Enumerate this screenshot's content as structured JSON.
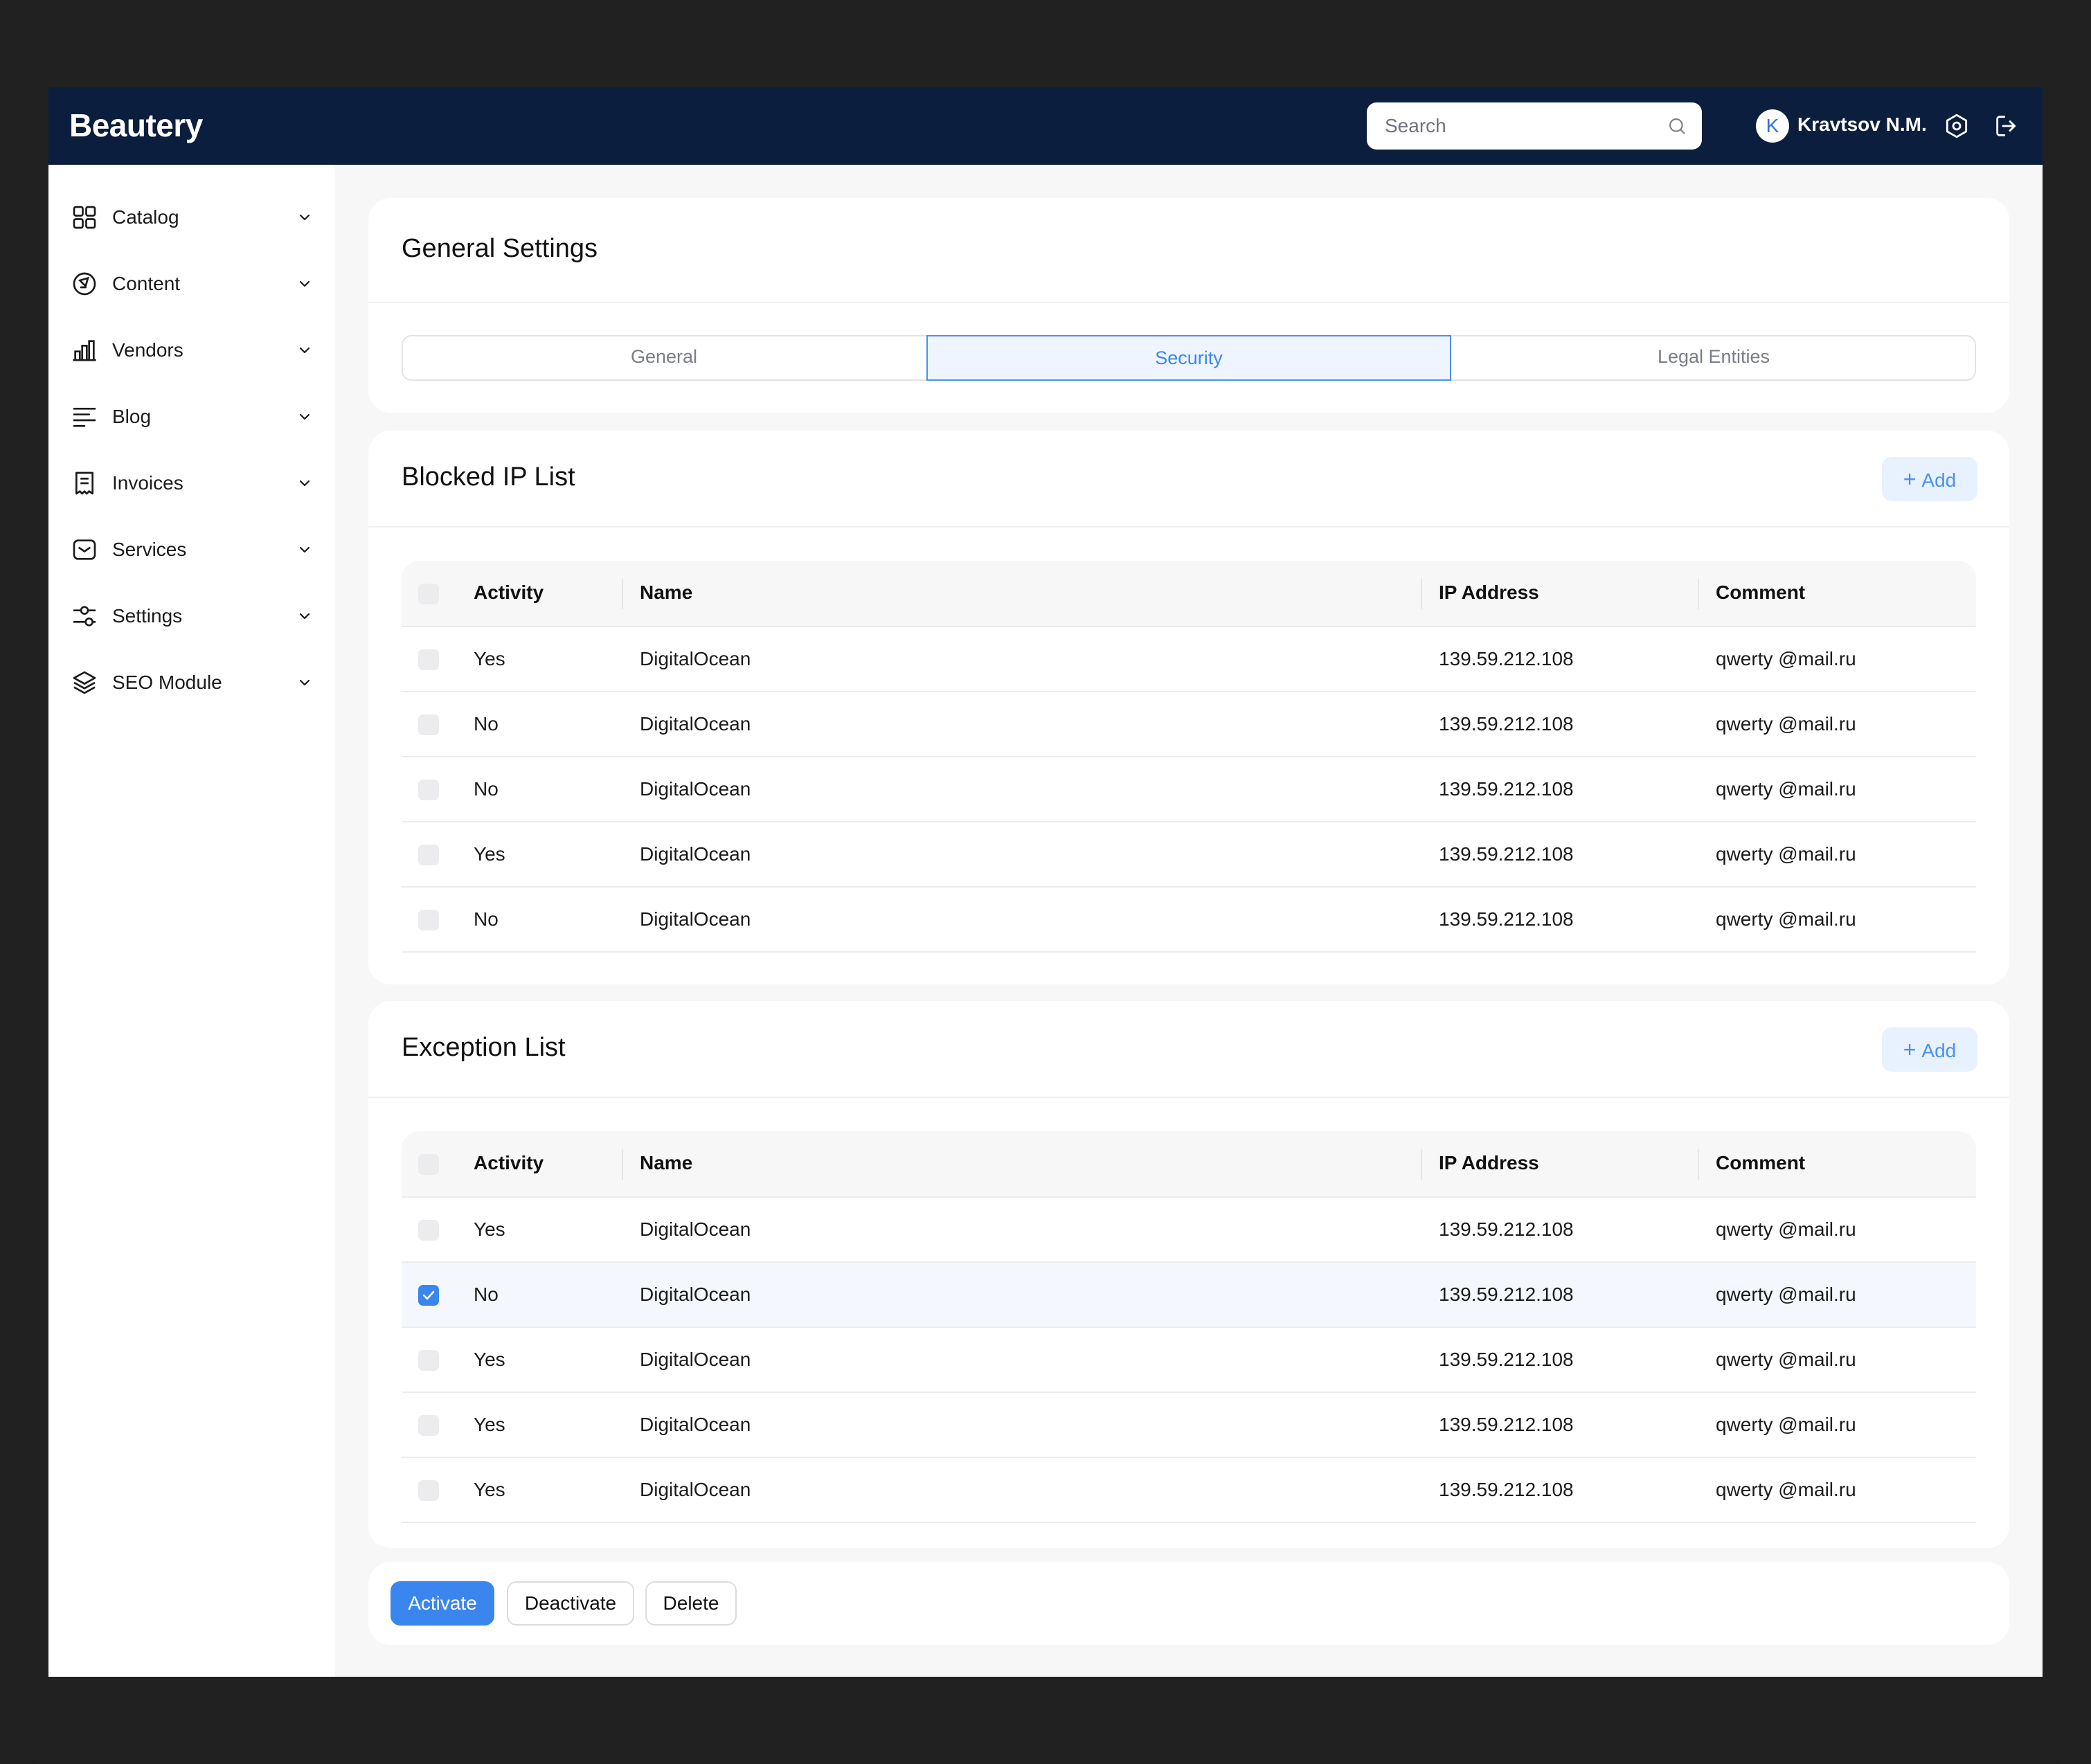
{
  "app": {
    "name": "Beautery"
  },
  "search": {
    "placeholder": "Search"
  },
  "user": {
    "initial": "K",
    "name": "Kravtsov N.M."
  },
  "sidebar": {
    "items": [
      {
        "label": "Catalog",
        "icon": "grid-icon"
      },
      {
        "label": "Content",
        "icon": "content-icon"
      },
      {
        "label": "Vendors",
        "icon": "bar-chart-icon"
      },
      {
        "label": "Blog",
        "icon": "text-lines-icon"
      },
      {
        "label": "Invoices",
        "icon": "receipt-icon"
      },
      {
        "label": "Services",
        "icon": "mail-icon"
      },
      {
        "label": "Settings",
        "icon": "sliders-icon"
      },
      {
        "label": "SEO Module",
        "icon": "layers-icon"
      }
    ]
  },
  "general_settings": {
    "title": "General Settings",
    "tabs": [
      {
        "label": "General",
        "active": false
      },
      {
        "label": "Security",
        "active": true
      },
      {
        "label": "Legal Entities",
        "active": false
      }
    ]
  },
  "columns": {
    "activity": "Activity",
    "name": "Name",
    "ip": "IP Address",
    "comment": "Comment"
  },
  "blocked": {
    "title": "Blocked IP List",
    "add_label": "Add",
    "rows": [
      {
        "checked": false,
        "activity": "Yes",
        "name": "DigitalOcean",
        "ip": "139.59.212.108",
        "comment": "qwerty @mail.ru"
      },
      {
        "checked": false,
        "activity": "No",
        "name": "DigitalOcean",
        "ip": "139.59.212.108",
        "comment": "qwerty @mail.ru"
      },
      {
        "checked": false,
        "activity": "No",
        "name": "DigitalOcean",
        "ip": "139.59.212.108",
        "comment": "qwerty @mail.ru"
      },
      {
        "checked": false,
        "activity": "Yes",
        "name": "DigitalOcean",
        "ip": "139.59.212.108",
        "comment": "qwerty @mail.ru"
      },
      {
        "checked": false,
        "activity": "No",
        "name": "DigitalOcean",
        "ip": "139.59.212.108",
        "comment": "qwerty @mail.ru"
      }
    ]
  },
  "exception": {
    "title": "Exception List",
    "add_label": "Add",
    "rows": [
      {
        "checked": false,
        "activity": "Yes",
        "name": "DigitalOcean",
        "ip": "139.59.212.108",
        "comment": "qwerty @mail.ru"
      },
      {
        "checked": true,
        "activity": "No",
        "name": "DigitalOcean",
        "ip": "139.59.212.108",
        "comment": "qwerty @mail.ru"
      },
      {
        "checked": false,
        "activity": "Yes",
        "name": "DigitalOcean",
        "ip": "139.59.212.108",
        "comment": "qwerty @mail.ru"
      },
      {
        "checked": false,
        "activity": "Yes",
        "name": "DigitalOcean",
        "ip": "139.59.212.108",
        "comment": "qwerty @mail.ru"
      },
      {
        "checked": false,
        "activity": "Yes",
        "name": "DigitalOcean",
        "ip": "139.59.212.108",
        "comment": "qwerty @mail.ru"
      }
    ]
  },
  "actions": {
    "activate": "Activate",
    "deactivate": "Deactivate",
    "delete": "Delete"
  },
  "colors": {
    "topbar": "#0c1e3e",
    "accent": "#3a86ee",
    "page_bg": "#f7f7f8"
  }
}
